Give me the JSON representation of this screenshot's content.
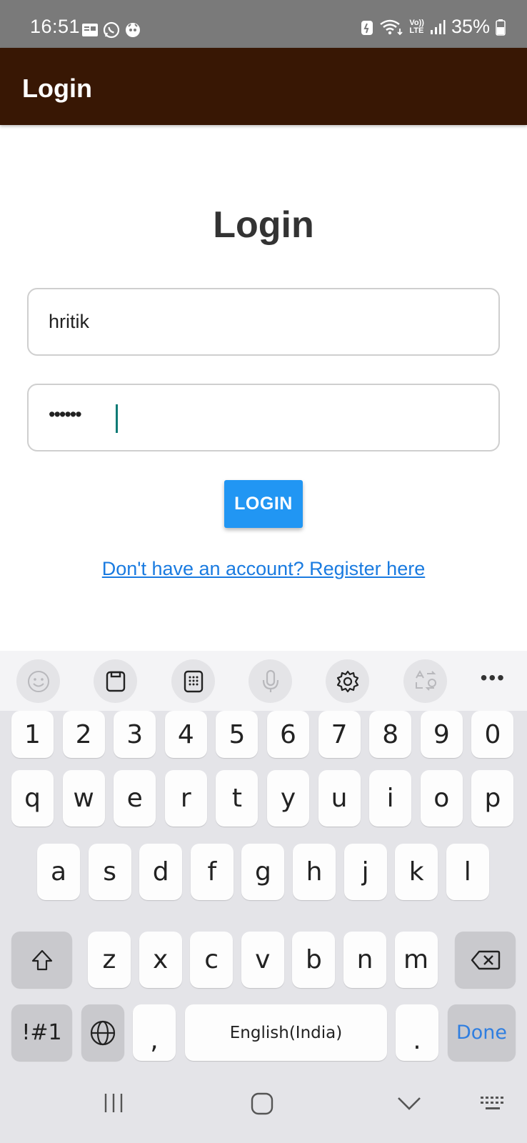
{
  "status_bar": {
    "time": "16:51",
    "battery_percent": "35%",
    "left_icons": [
      "message-icon",
      "whatsapp-icon",
      "app-notification-icon"
    ],
    "right_icons": [
      "battery-saver-icon",
      "wifi-icon",
      "volte-icon",
      "signal-icon",
      "battery-icon"
    ],
    "volte_label_top": "Vo))",
    "volte_label_bottom": "LTE"
  },
  "app_bar": {
    "title": "Login"
  },
  "form": {
    "heading": "Login",
    "username_value": "hritik",
    "password_value": "••••••",
    "login_button_label": "LOGIN",
    "register_link_text": "Don't have an account? Register here"
  },
  "keyboard": {
    "toolbar": [
      "emoji-icon",
      "clipboard-icon",
      "keypad-icon",
      "microphone-icon",
      "settings-icon",
      "translate-icon",
      "more-icon"
    ],
    "more_label": "•••",
    "number_row": [
      "1",
      "2",
      "3",
      "4",
      "5",
      "6",
      "7",
      "8",
      "9",
      "0"
    ],
    "row1": [
      "q",
      "w",
      "e",
      "r",
      "t",
      "y",
      "u",
      "i",
      "o",
      "p"
    ],
    "row2": [
      "a",
      "s",
      "d",
      "f",
      "g",
      "h",
      "j",
      "k",
      "l"
    ],
    "row3": [
      "z",
      "x",
      "c",
      "v",
      "b",
      "n",
      "m"
    ],
    "symbols_label": "!#1",
    "comma_label": ",",
    "space_label": "English(India)",
    "period_label": ".",
    "done_label": "Done"
  },
  "colors": {
    "status_bar": "#7a7a7a",
    "app_bar": "#381704",
    "button": "#2196f3",
    "link": "#1a7be0",
    "caret": "#0b7a75"
  }
}
